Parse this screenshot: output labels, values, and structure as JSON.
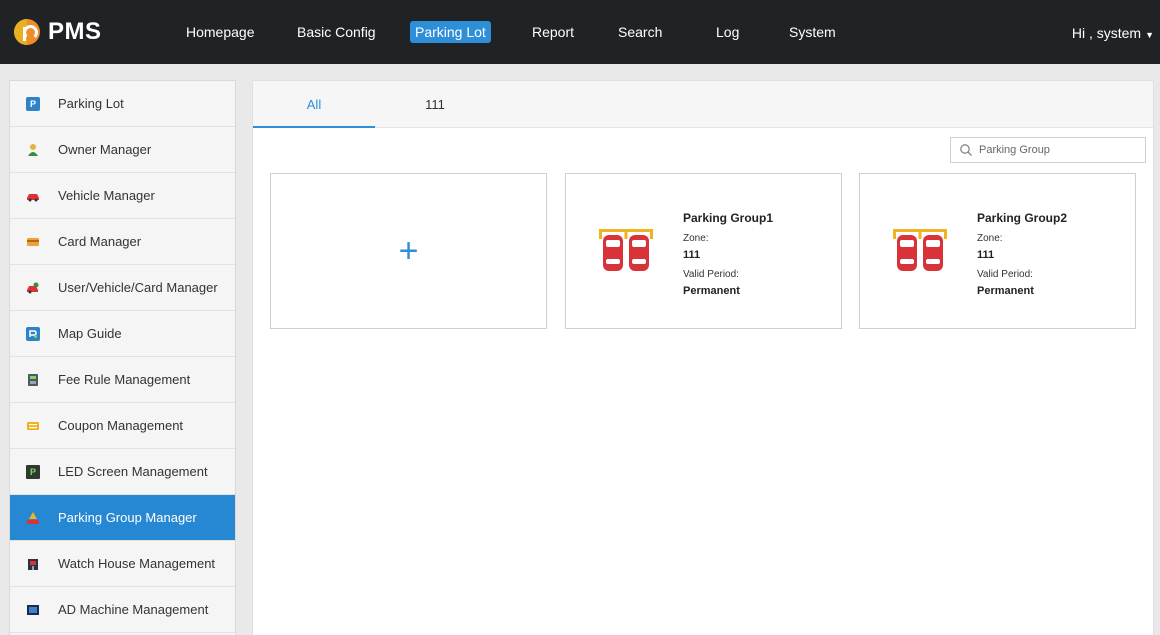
{
  "app": {
    "name": "PMS"
  },
  "nav": {
    "items": [
      {
        "label": "Homepage",
        "active": false
      },
      {
        "label": "Basic Config",
        "active": false
      },
      {
        "label": "Parking Lot",
        "active": true
      },
      {
        "label": "Report",
        "active": false
      },
      {
        "label": "Search",
        "active": false
      },
      {
        "label": "Log",
        "active": false
      },
      {
        "label": "System",
        "active": false
      }
    ],
    "user": "Hi , system"
  },
  "sidebar": {
    "items": [
      {
        "label": "Parking Lot",
        "icon": "parking-icon",
        "active": false
      },
      {
        "label": "Owner Manager",
        "icon": "person-icon",
        "active": false
      },
      {
        "label": "Vehicle Manager",
        "icon": "car-icon",
        "active": false
      },
      {
        "label": "Card Manager",
        "icon": "card-icon",
        "active": false
      },
      {
        "label": "User/Vehicle/Card Manager",
        "icon": "user-vehicle-card-icon",
        "active": false
      },
      {
        "label": "Map Guide",
        "icon": "map-icon",
        "active": false
      },
      {
        "label": "Fee Rule Management",
        "icon": "fee-icon",
        "active": false
      },
      {
        "label": "Coupon Management",
        "icon": "coupon-icon",
        "active": false
      },
      {
        "label": "LED Screen Management",
        "icon": "led-screen-icon",
        "active": false
      },
      {
        "label": "Parking Group Manager",
        "icon": "parking-group-icon",
        "active": true
      },
      {
        "label": "Watch House Management",
        "icon": "watch-house-icon",
        "active": false
      },
      {
        "label": "AD Machine Management",
        "icon": "ad-machine-icon",
        "active": false
      }
    ]
  },
  "main": {
    "tabs": [
      {
        "label": "All",
        "active": true
      },
      {
        "label": "111",
        "active": false
      }
    ],
    "search": {
      "placeholder": "Parking Group"
    },
    "add_label": "+",
    "groups": [
      {
        "name": "Parking Group1",
        "zone_label": "Zone:",
        "zone": "111",
        "period_label": "Valid Period:",
        "period": "Permanent"
      },
      {
        "name": "Parking Group2",
        "zone_label": "Zone:",
        "zone": "111",
        "period_label": "Valid Period:",
        "period": "Permanent"
      }
    ]
  },
  "colors": {
    "accent": "#2e8fd8",
    "topbar": "#1f2326",
    "car": "#d9333a",
    "barrier": "#f1b21f"
  }
}
